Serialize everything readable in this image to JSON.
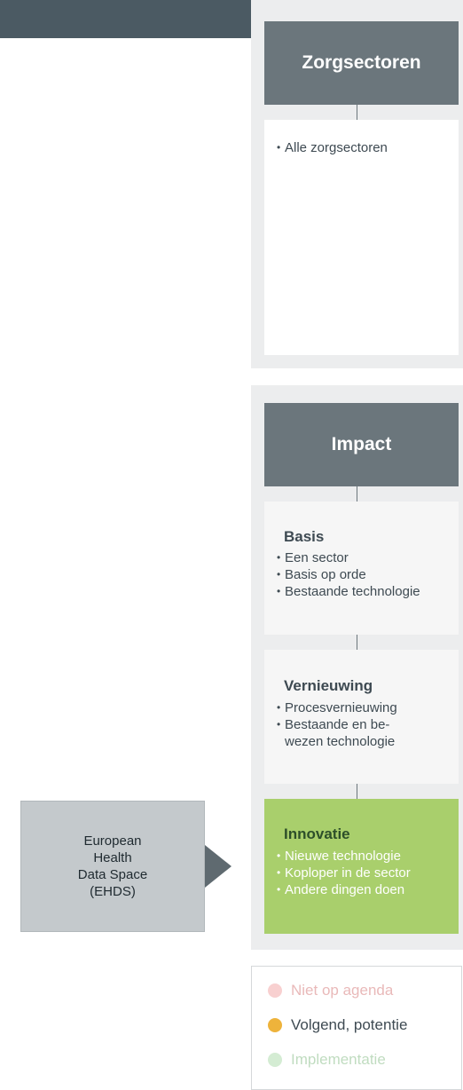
{
  "sectors": {
    "title": "Zorgsectoren",
    "items": [
      "Alle zorgsectoren"
    ]
  },
  "impact": {
    "title": "Impact",
    "basis": {
      "title": "Basis",
      "items": [
        "Een sector",
        "Basis op orde",
        "Bestaande technologie"
      ]
    },
    "vernieuwing": {
      "title": "Vernieuwing",
      "items": [
        "Procesvernieuwing",
        "Bestaande en be-",
        "wezen technologie"
      ]
    },
    "innovatie": {
      "title": "Innovatie",
      "items": [
        "Nieuwe technologie",
        "Koploper in de sector",
        "Andere dingen doen"
      ]
    }
  },
  "ehds": {
    "line1": "European",
    "line2": "Health",
    "line3": "Data Space",
    "line4": "(EHDS)"
  },
  "legend": {
    "items": [
      {
        "label": "Niet op agenda",
        "color": "#f8d0d0",
        "text_color": "#e9b9b9"
      },
      {
        "label": "Volgend, potentie",
        "color": "#eeb33b",
        "text_color": "#3e4a52"
      },
      {
        "label": "Implementatie",
        "color": "#d4ecd3",
        "text_color": "#c0dcc0"
      }
    ]
  },
  "colors": {
    "header": "#6b767c",
    "topbar": "#4b5a63",
    "innovatie": "#a9cf6c",
    "panel": "#ecedee"
  }
}
